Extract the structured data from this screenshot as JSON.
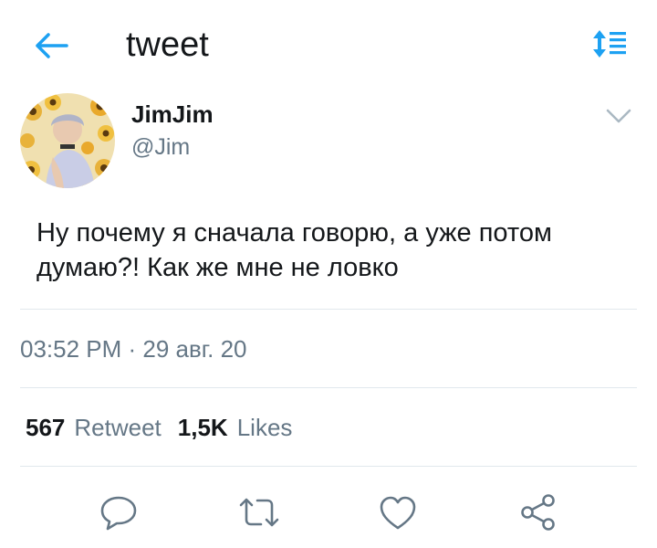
{
  "header": {
    "title": "tweet",
    "back_icon": "arrow-left-icon",
    "sort_icon": "sort-list-icon",
    "accent_color": "#1da1f2"
  },
  "author": {
    "display_name": "JimJim",
    "handle": "@Jim",
    "menu_icon": "chevron-down-icon"
  },
  "tweet": {
    "text": "Ну почему я сначала говорю, а уже потом думаю?! Как же мне не ловко",
    "timestamp": "03:52 PM · 29 авг. 20"
  },
  "stats": {
    "retweets_count": "567",
    "retweets_label": "Retweet",
    "likes_count": "1,5K",
    "likes_label": "Likes"
  },
  "actions": [
    {
      "icon": "reply-icon"
    },
    {
      "icon": "retweet-icon"
    },
    {
      "icon": "like-icon"
    },
    {
      "icon": "share-icon"
    }
  ],
  "colors": {
    "text_primary": "#14171a",
    "text_secondary": "#657786",
    "divider": "#e1e8ed",
    "icon_gray": "#657786"
  }
}
